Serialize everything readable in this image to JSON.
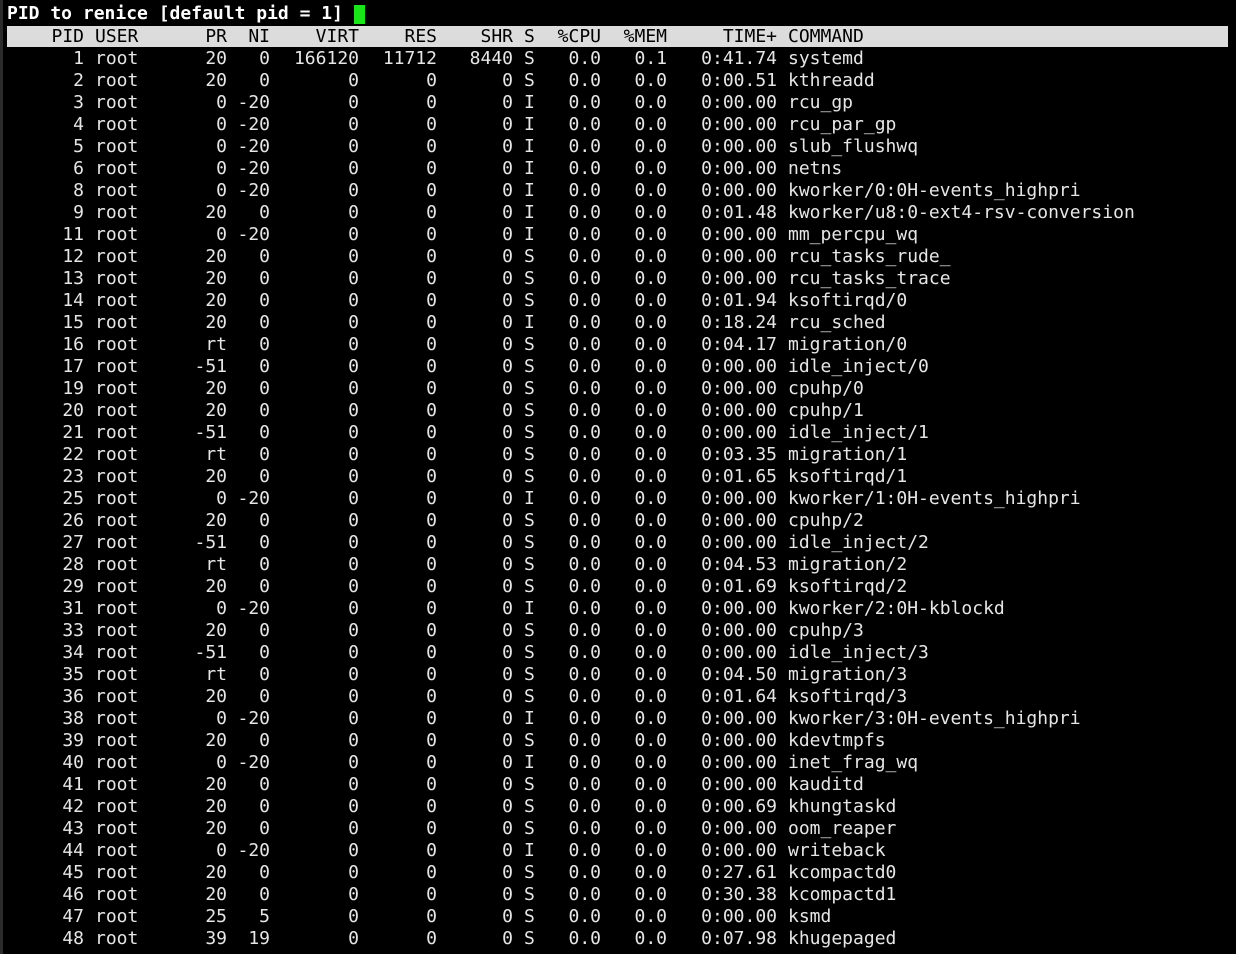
{
  "prompt": {
    "text": "PID to renice [default pid = 1]"
  },
  "colors": {
    "background": "#000000",
    "text": "#e6e6e6",
    "header_bg": "#dcdcdc",
    "header_text": "#000000",
    "cursor": "#19e619"
  },
  "table": {
    "columns": [
      "PID",
      "USER",
      "PR",
      "NI",
      "VIRT",
      "RES",
      "SHR",
      "S",
      "%CPU",
      "%MEM",
      "TIME+",
      "COMMAND"
    ],
    "rows": [
      [
        "1",
        "root",
        "20",
        "0",
        "166120",
        "11712",
        "8440",
        "S",
        "0.0",
        "0.1",
        "0:41.74",
        "systemd"
      ],
      [
        "2",
        "root",
        "20",
        "0",
        "0",
        "0",
        "0",
        "S",
        "0.0",
        "0.0",
        "0:00.51",
        "kthreadd"
      ],
      [
        "3",
        "root",
        "0",
        "-20",
        "0",
        "0",
        "0",
        "I",
        "0.0",
        "0.0",
        "0:00.00",
        "rcu_gp"
      ],
      [
        "4",
        "root",
        "0",
        "-20",
        "0",
        "0",
        "0",
        "I",
        "0.0",
        "0.0",
        "0:00.00",
        "rcu_par_gp"
      ],
      [
        "5",
        "root",
        "0",
        "-20",
        "0",
        "0",
        "0",
        "I",
        "0.0",
        "0.0",
        "0:00.00",
        "slub_flushwq"
      ],
      [
        "6",
        "root",
        "0",
        "-20",
        "0",
        "0",
        "0",
        "I",
        "0.0",
        "0.0",
        "0:00.00",
        "netns"
      ],
      [
        "8",
        "root",
        "0",
        "-20",
        "0",
        "0",
        "0",
        "I",
        "0.0",
        "0.0",
        "0:00.00",
        "kworker/0:0H-events_highpri"
      ],
      [
        "9",
        "root",
        "20",
        "0",
        "0",
        "0",
        "0",
        "I",
        "0.0",
        "0.0",
        "0:01.48",
        "kworker/u8:0-ext4-rsv-conversion"
      ],
      [
        "11",
        "root",
        "0",
        "-20",
        "0",
        "0",
        "0",
        "I",
        "0.0",
        "0.0",
        "0:00.00",
        "mm_percpu_wq"
      ],
      [
        "12",
        "root",
        "20",
        "0",
        "0",
        "0",
        "0",
        "S",
        "0.0",
        "0.0",
        "0:00.00",
        "rcu_tasks_rude_"
      ],
      [
        "13",
        "root",
        "20",
        "0",
        "0",
        "0",
        "0",
        "S",
        "0.0",
        "0.0",
        "0:00.00",
        "rcu_tasks_trace"
      ],
      [
        "14",
        "root",
        "20",
        "0",
        "0",
        "0",
        "0",
        "S",
        "0.0",
        "0.0",
        "0:01.94",
        "ksoftirqd/0"
      ],
      [
        "15",
        "root",
        "20",
        "0",
        "0",
        "0",
        "0",
        "I",
        "0.0",
        "0.0",
        "0:18.24",
        "rcu_sched"
      ],
      [
        "16",
        "root",
        "rt",
        "0",
        "0",
        "0",
        "0",
        "S",
        "0.0",
        "0.0",
        "0:04.17",
        "migration/0"
      ],
      [
        "17",
        "root",
        "-51",
        "0",
        "0",
        "0",
        "0",
        "S",
        "0.0",
        "0.0",
        "0:00.00",
        "idle_inject/0"
      ],
      [
        "19",
        "root",
        "20",
        "0",
        "0",
        "0",
        "0",
        "S",
        "0.0",
        "0.0",
        "0:00.00",
        "cpuhp/0"
      ],
      [
        "20",
        "root",
        "20",
        "0",
        "0",
        "0",
        "0",
        "S",
        "0.0",
        "0.0",
        "0:00.00",
        "cpuhp/1"
      ],
      [
        "21",
        "root",
        "-51",
        "0",
        "0",
        "0",
        "0",
        "S",
        "0.0",
        "0.0",
        "0:00.00",
        "idle_inject/1"
      ],
      [
        "22",
        "root",
        "rt",
        "0",
        "0",
        "0",
        "0",
        "S",
        "0.0",
        "0.0",
        "0:03.35",
        "migration/1"
      ],
      [
        "23",
        "root",
        "20",
        "0",
        "0",
        "0",
        "0",
        "S",
        "0.0",
        "0.0",
        "0:01.65",
        "ksoftirqd/1"
      ],
      [
        "25",
        "root",
        "0",
        "-20",
        "0",
        "0",
        "0",
        "I",
        "0.0",
        "0.0",
        "0:00.00",
        "kworker/1:0H-events_highpri"
      ],
      [
        "26",
        "root",
        "20",
        "0",
        "0",
        "0",
        "0",
        "S",
        "0.0",
        "0.0",
        "0:00.00",
        "cpuhp/2"
      ],
      [
        "27",
        "root",
        "-51",
        "0",
        "0",
        "0",
        "0",
        "S",
        "0.0",
        "0.0",
        "0:00.00",
        "idle_inject/2"
      ],
      [
        "28",
        "root",
        "rt",
        "0",
        "0",
        "0",
        "0",
        "S",
        "0.0",
        "0.0",
        "0:04.53",
        "migration/2"
      ],
      [
        "29",
        "root",
        "20",
        "0",
        "0",
        "0",
        "0",
        "S",
        "0.0",
        "0.0",
        "0:01.69",
        "ksoftirqd/2"
      ],
      [
        "31",
        "root",
        "0",
        "-20",
        "0",
        "0",
        "0",
        "I",
        "0.0",
        "0.0",
        "0:00.00",
        "kworker/2:0H-kblockd"
      ],
      [
        "33",
        "root",
        "20",
        "0",
        "0",
        "0",
        "0",
        "S",
        "0.0",
        "0.0",
        "0:00.00",
        "cpuhp/3"
      ],
      [
        "34",
        "root",
        "-51",
        "0",
        "0",
        "0",
        "0",
        "S",
        "0.0",
        "0.0",
        "0:00.00",
        "idle_inject/3"
      ],
      [
        "35",
        "root",
        "rt",
        "0",
        "0",
        "0",
        "0",
        "S",
        "0.0",
        "0.0",
        "0:04.50",
        "migration/3"
      ],
      [
        "36",
        "root",
        "20",
        "0",
        "0",
        "0",
        "0",
        "S",
        "0.0",
        "0.0",
        "0:01.64",
        "ksoftirqd/3"
      ],
      [
        "38",
        "root",
        "0",
        "-20",
        "0",
        "0",
        "0",
        "I",
        "0.0",
        "0.0",
        "0:00.00",
        "kworker/3:0H-events_highpri"
      ],
      [
        "39",
        "root",
        "20",
        "0",
        "0",
        "0",
        "0",
        "S",
        "0.0",
        "0.0",
        "0:00.00",
        "kdevtmpfs"
      ],
      [
        "40",
        "root",
        "0",
        "-20",
        "0",
        "0",
        "0",
        "I",
        "0.0",
        "0.0",
        "0:00.00",
        "inet_frag_wq"
      ],
      [
        "41",
        "root",
        "20",
        "0",
        "0",
        "0",
        "0",
        "S",
        "0.0",
        "0.0",
        "0:00.00",
        "kauditd"
      ],
      [
        "42",
        "root",
        "20",
        "0",
        "0",
        "0",
        "0",
        "S",
        "0.0",
        "0.0",
        "0:00.69",
        "khungtaskd"
      ],
      [
        "43",
        "root",
        "20",
        "0",
        "0",
        "0",
        "0",
        "S",
        "0.0",
        "0.0",
        "0:00.00",
        "oom_reaper"
      ],
      [
        "44",
        "root",
        "0",
        "-20",
        "0",
        "0",
        "0",
        "I",
        "0.0",
        "0.0",
        "0:00.00",
        "writeback"
      ],
      [
        "45",
        "root",
        "20",
        "0",
        "0",
        "0",
        "0",
        "S",
        "0.0",
        "0.0",
        "0:27.61",
        "kcompactd0"
      ],
      [
        "46",
        "root",
        "20",
        "0",
        "0",
        "0",
        "0",
        "S",
        "0.0",
        "0.0",
        "0:30.38",
        "kcompactd1"
      ],
      [
        "47",
        "root",
        "25",
        "5",
        "0",
        "0",
        "0",
        "S",
        "0.0",
        "0.0",
        "0:00.00",
        "ksmd"
      ],
      [
        "48",
        "root",
        "39",
        "19",
        "0",
        "0",
        "0",
        "S",
        "0.0",
        "0.0",
        "0:07.98",
        "khugepaged"
      ]
    ]
  }
}
